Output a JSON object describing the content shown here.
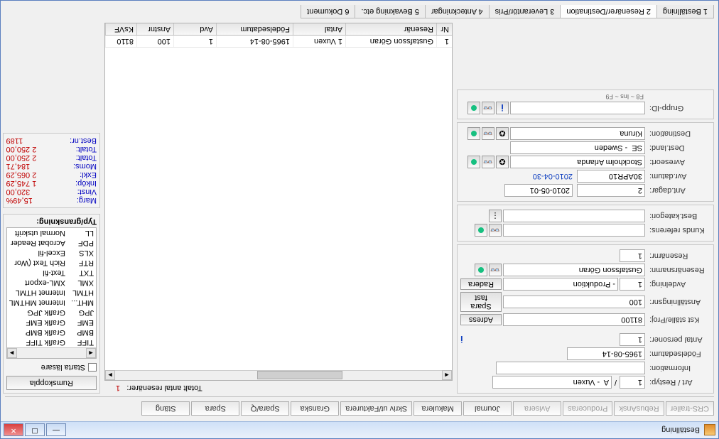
{
  "window": {
    "title": "Beställning"
  },
  "toolbar": {
    "crs": "CRS-trailer",
    "rebus": "RebusAnsk",
    "prod": "Produceras",
    "avisera": "Avisera",
    "journal": "Journal",
    "makulera": "Makulera",
    "skriv": "Skriv ut/Fakturera",
    "granska": "Granska",
    "sparaq": "Spara/Q",
    "spara": "Spara",
    "stang": "Stäng"
  },
  "labels": {
    "art_restyp": "Art / Restyp:",
    "information": "Information:",
    "fodelsedatum": "Födelsedatum:",
    "antal_personer": "Antal personer:",
    "kststalle": "Kst ställe/Proj:",
    "anstallningsnr": "Anställningsnr:",
    "avdelning": "Avdelning:",
    "resenarnamn": "Resenärsnamn:",
    "resenarnr": "Resenärnr:",
    "kunds_referens": "Kunds referens:",
    "best_kategori": "Best.kategori:",
    "ant_dagar": "Ant.dagar:",
    "avr_datum": "Avr.datum:",
    "avreseort": "Avreseort:",
    "dest_land": "Dest.land:",
    "destination": "Destination:",
    "grupp_id": "Grupp-ID:",
    "hint_fkeys": "F8 ~ Ins ~ F9"
  },
  "values": {
    "art": "1",
    "restyp": "A  - Vuxen",
    "fodelsedatum": "1965-08-14",
    "antal_personer": "1",
    "kststalle": "81100",
    "anstallningsnr": "100",
    "avdelning_nr": "1",
    "avdelning_txt": "- Produktion",
    "resenarnamn": "Gustafsson Göran",
    "resenarnr": "1",
    "ant_dagar": "2",
    "ant_dagar_date": "2010-05-01",
    "avr_datum": "30APR10",
    "avr_datum_iso": "2010-04-30",
    "avreseort": "Stockholm Arlanda",
    "dest_land": "SE  - Sweden",
    "destination": "Kiruna"
  },
  "buttons": {
    "adress": "Adress",
    "spara_fast": "Spara fast",
    "radera": "Radera",
    "rumskoppla": "Rumskoppla",
    "starta_lasare": "Starta läsare"
  },
  "mid": {
    "header": "Totalt antal resenärer:",
    "count": "1",
    "cols": {
      "nr": "Nr",
      "resenar": "Resenär",
      "antal": "Antal",
      "fodelsedatum": "Födelsedatum",
      "avd": "Avd",
      "anstnr": "Anstnr",
      "ksvf": "KsVF"
    },
    "row": {
      "nr": "1",
      "resenar": "Gustafsson Göran",
      "antal": "1 Vuxen",
      "fd": "1965-08-14",
      "avd": "1",
      "anstnr": "100",
      "ks": "8110"
    }
  },
  "types": {
    "caption": "Typ/granskning:",
    "items": [
      {
        "c1": "TIFF",
        "c2": "Grafik TIFF"
      },
      {
        "c1": "BMP",
        "c2": "Grafik BMP"
      },
      {
        "c1": "EMF",
        "c2": "Grafik EMF"
      },
      {
        "c1": "JPG",
        "c2": "Grafik JPG"
      },
      {
        "c1": "MHT...",
        "c2": "Internet MHTML"
      },
      {
        "c1": "HTML",
        "c2": "Internet HTML"
      },
      {
        "c1": "XML",
        "c2": "XML-export"
      },
      {
        "c1": "TXT",
        "c2": "Text-fil"
      },
      {
        "c1": "RTF",
        "c2": "Rich Text (Wor"
      },
      {
        "c1": "XLS",
        "c2": "Excel-fil"
      },
      {
        "c1": "PDF",
        "c2": "Acrobat Reader"
      },
      {
        "c1": "LL",
        "c2": "Normal utskrift"
      }
    ]
  },
  "summary": {
    "rows": [
      {
        "k": "Marg:",
        "v": "15,49%"
      },
      {
        "k": "Vinst:",
        "v": "320,00"
      },
      {
        "k": "Inköp:",
        "v": "1 745,29"
      },
      {
        "k": "Exkl:",
        "v": "2 065,29"
      },
      {
        "k": "Moms:",
        "v": "184,71"
      },
      {
        "k": "Totalt:",
        "v": "2 250,00"
      },
      {
        "k": "Totalt:",
        "v": "2 250,00"
      },
      {
        "k": "Best.nr:",
        "v": "1189"
      }
    ]
  },
  "tabs": {
    "t1": "1 Beställning",
    "t2": "2 Resenärer/Destination",
    "t3": "3 Leverantör/Pris",
    "t4": "4 Anteckningar",
    "t5": "5 Bevakning etc.",
    "t6": "6 Dokument"
  }
}
